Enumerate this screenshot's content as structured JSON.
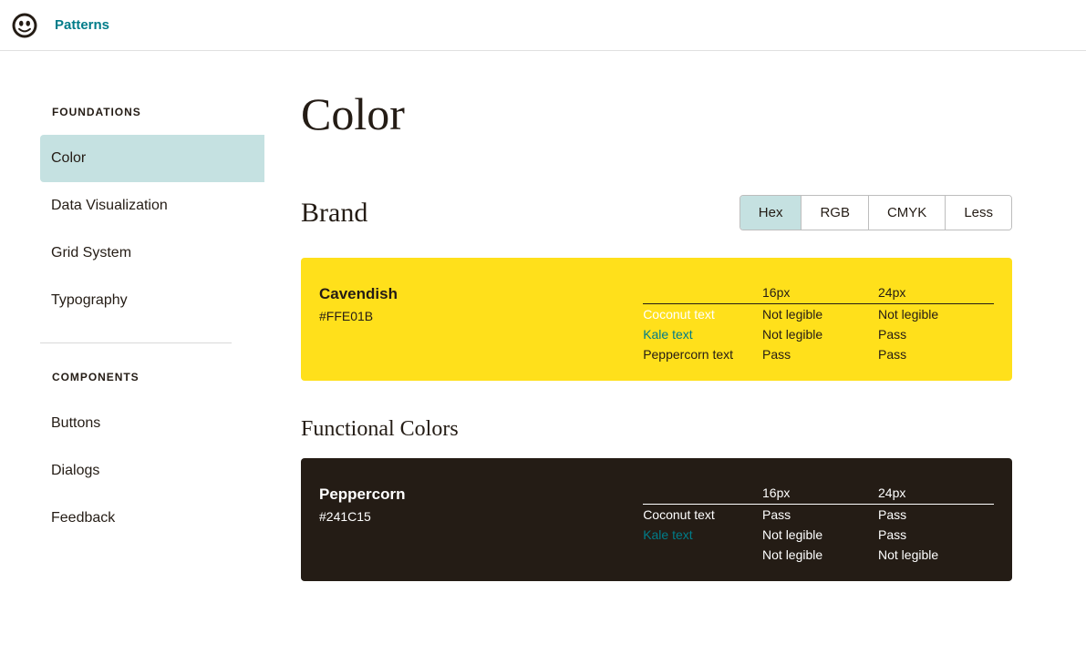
{
  "topbar": {
    "brand": "Patterns"
  },
  "sidebar": {
    "section1_title": "FOUNDATIONS",
    "section1_items": [
      "Color",
      "Data Visualization",
      "Grid System",
      "Typography"
    ],
    "section2_title": "COMPONENTS",
    "section2_items": [
      "Buttons",
      "Dialogs",
      "Feedback"
    ]
  },
  "page": {
    "title": "Color",
    "brand_heading": "Brand",
    "functional_heading": "Functional Colors",
    "format_tabs": [
      "Hex",
      "RGB",
      "CMYK",
      "Less"
    ]
  },
  "swatches": {
    "cavendish": {
      "name": "Cavendish",
      "value": "#FFE01B",
      "headers": {
        "c1": "",
        "c2": "16px",
        "c3": "24px"
      },
      "rows": [
        {
          "label": "Coconut text",
          "class": "coconut-on-cavendish",
          "v16": "Not legible",
          "v24": "Not legible"
        },
        {
          "label": "Kale text",
          "class": "kale-on-cavendish",
          "v16": "Not legible",
          "v24": "Pass"
        },
        {
          "label": "Peppercorn text",
          "class": "",
          "v16": "Pass",
          "v24": "Pass"
        }
      ]
    },
    "peppercorn": {
      "name": "Peppercorn",
      "value": "#241C15",
      "headers": {
        "c1": "",
        "c2": "16px",
        "c3": "24px"
      },
      "rows": [
        {
          "label": "Coconut text",
          "class": "coconut-on-peppercorn",
          "v16": "Pass",
          "v24": "Pass"
        },
        {
          "label": "Kale text",
          "class": "kale-on-dark",
          "v16": "Not legible",
          "v24": "Pass"
        },
        {
          "label": "",
          "class": "",
          "v16": "Not legible",
          "v24": "Not legible"
        }
      ]
    }
  }
}
